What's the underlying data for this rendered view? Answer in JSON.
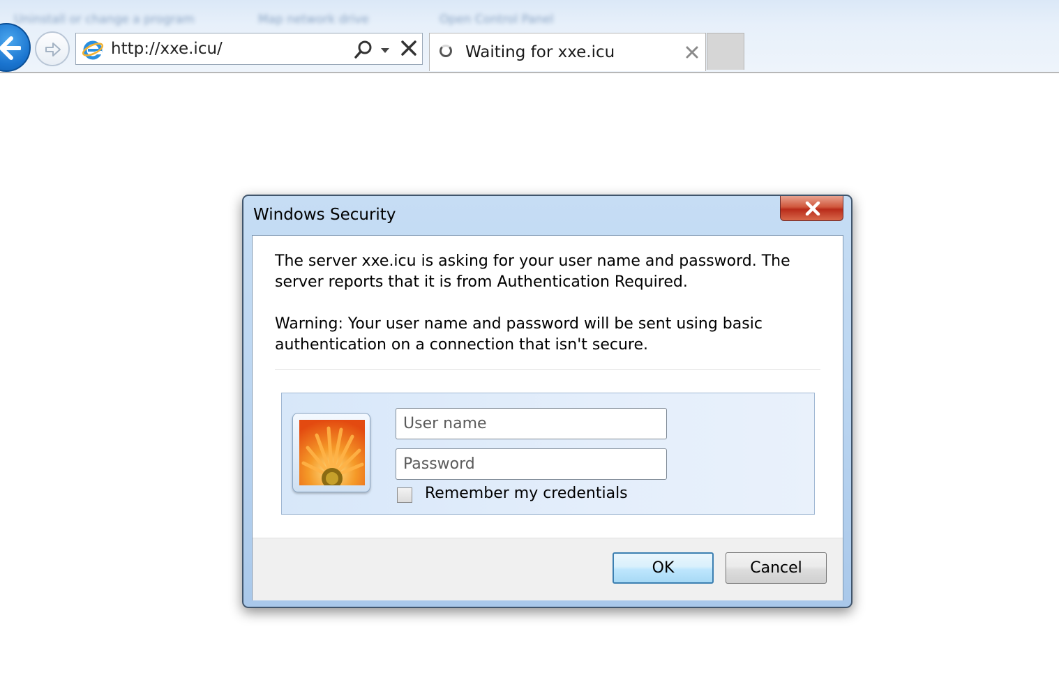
{
  "browser": {
    "favorites": [
      "Uninstall or change a program",
      "Map network drive",
      "Open Control Panel"
    ],
    "address": "http://xxe.icu/",
    "tab": {
      "title": "Waiting for xxe.icu"
    }
  },
  "dialog": {
    "title": "Windows Security",
    "message": "The server xxe.icu is asking for your user name and password. The server reports that it is from Authentication Required.",
    "warning": "Warning: Your user name and password will be sent using basic authentication on a connection that isn't secure.",
    "username_placeholder": "User name",
    "password_placeholder": "Password",
    "remember_label": "Remember my credentials",
    "remember_checked": false,
    "ok_label": "OK",
    "cancel_label": "Cancel"
  },
  "colors": {
    "accent": "#1a74cf",
    "close_red": "#c7432b"
  }
}
